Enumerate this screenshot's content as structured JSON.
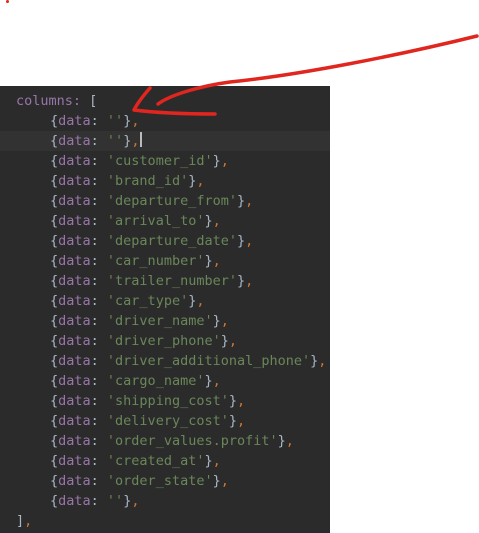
{
  "editor": {
    "open_line": "columns:",
    "open_bracket": "[",
    "rows": [
      {
        "value": "''"
      },
      {
        "value": "''"
      },
      {
        "value": "'customer_id'"
      },
      {
        "value": "'brand_id'"
      },
      {
        "value": "'departure_from'"
      },
      {
        "value": "'arrival_to'"
      },
      {
        "value": "'departure_date'"
      },
      {
        "value": "'car_number'"
      },
      {
        "value": "'trailer_number'"
      },
      {
        "value": "'car_type'"
      },
      {
        "value": "'driver_name'"
      },
      {
        "value": "'driver_phone'"
      },
      {
        "value": "'driver_additional_phone'"
      },
      {
        "value": "'cargo_name'"
      },
      {
        "value": "'shipping_cost'"
      },
      {
        "value": "'delivery_cost'"
      },
      {
        "value": "'order_values.profit'"
      },
      {
        "value": "'created_at'"
      },
      {
        "value": "'order_state'"
      },
      {
        "value": "''"
      }
    ],
    "row_prefix": "{data: ",
    "row_suffix": "}",
    "comma": ",",
    "close_line": "]",
    "close_comma": ","
  },
  "colors": {
    "background": "#2b2b2b",
    "key": "#9876aa",
    "string": "#6a8759",
    "punctuation": "#cc7832",
    "annotation_arrow": "#e0261f"
  }
}
